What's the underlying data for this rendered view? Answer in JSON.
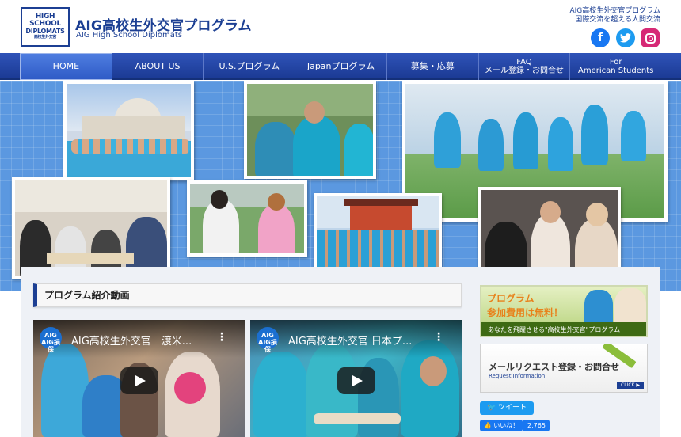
{
  "header": {
    "logo_lines": [
      "HIGH",
      "SCHOOL",
      "DIPLOMATS",
      "高校生外交官"
    ],
    "site_title": "AIG高校生外交官プログラム",
    "site_subtitle": "AIG High School Diplomats",
    "tagline_1": "AIG高校生外交官プログラム",
    "tagline_2": "国際交流を超える人間交流",
    "social": {
      "facebook_glyph": "f"
    }
  },
  "nav": {
    "items": [
      {
        "label": "HOME"
      },
      {
        "label": "ABOUT US"
      },
      {
        "label": "U.S.プログラム"
      },
      {
        "label": "Japanプログラム"
      },
      {
        "label": "募集・応募"
      },
      {
        "label_1": "FAQ",
        "label_2": "メール登録・お問合せ"
      },
      {
        "label_1": "For",
        "label_2": "American Students"
      }
    ]
  },
  "main": {
    "section_title": "プログラム紹介動画",
    "videos": [
      {
        "channel": "AIG\nAIG損保",
        "title": "AIG高校生外交官　渡米..."
      },
      {
        "channel": "AIG\nAIG損保",
        "title": "AIG高校生外交官 日本プ..."
      }
    ]
  },
  "sidebar": {
    "banner1_line1": "プログラム",
    "banner1_line2": "参加費用は無料！",
    "banner1_line3": "あなたを飛躍させる\"高校生外交官\"プログラム",
    "banner2_title": "メールリクエスト登録・お問合せ",
    "banner2_sub": "Request Information",
    "banner2_click": "CLICK ▶",
    "tweet_label": "ツイート",
    "like_label": "いいね！",
    "like_count": "2,765"
  },
  "colors": {
    "brand": "#1c3f93",
    "nav": "#2547a8",
    "hero": "#5b98e0",
    "accent_orange": "#e8821c"
  }
}
